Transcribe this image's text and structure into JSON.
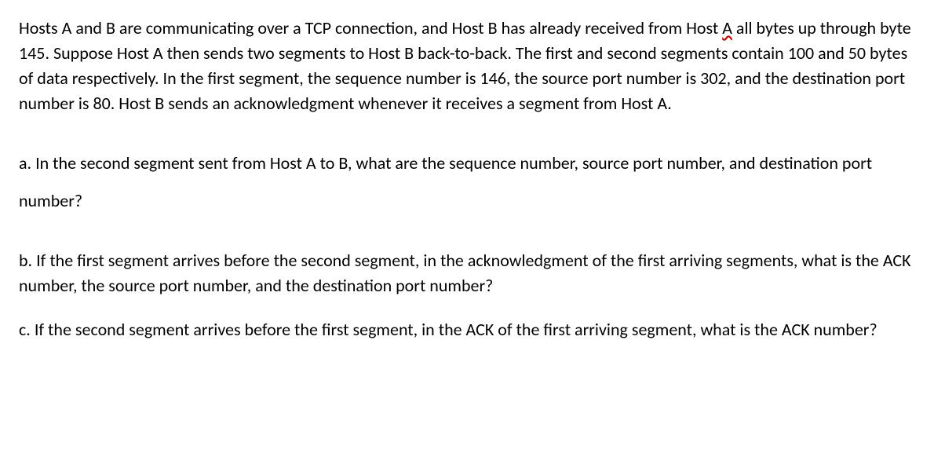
{
  "intro": {
    "line1_pre": "Hosts A and B are communicating over a TCP connection, and Host B has already received from Host ",
    "line1_wavy": "A",
    "line2": " all bytes up through byte 145. Suppose Host A then sends two segments to Host B back-to-back. The first and second segments contain 100 and 50 bytes of data respectively. In the first segment, the sequence number is 146, the source port number is 302, and the destination port number is 80. Host B sends an acknowledgment whenever it receives a segment from Host A."
  },
  "questions": {
    "a": "a. In the second segment sent from Host A to B, what are the sequence number, source port number, and destination port number?",
    "b": "b. If the first segment arrives before the second segment, in the acknowledgment of the first arriving segments, what is the ACK number, the source port number, and the destination port number?",
    "c": "c. If the second segment arrives before the first segment, in the ACK of the first arriving segment, what is the ACK number?"
  }
}
